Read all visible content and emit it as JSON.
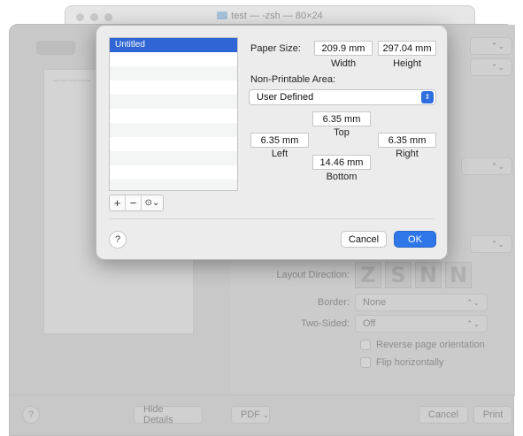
{
  "terminal": {
    "title": "test — -zsh — 80×24"
  },
  "print_dialog": {
    "preview_text": "Lorem ipsum. To be or not to be",
    "layout_direction_label": "Layout Direction:",
    "layout_icons": [
      "Z",
      "S",
      "N",
      "N"
    ],
    "border_label": "Border:",
    "border_value": "None",
    "two_sided_label": "Two-Sided:",
    "two_sided_value": "Off",
    "reverse_label": "Reverse page orientation",
    "flip_label": "Flip horizontally",
    "help_label": "?",
    "hide_details_label": "Hide Details",
    "pdf_label": "PDF",
    "cancel_label": "Cancel",
    "print_label": "Print"
  },
  "custom_paper": {
    "list_items": [
      "Untitled"
    ],
    "paper_size_label": "Paper Size:",
    "width_value": "209.9 mm",
    "width_label": "Width",
    "height_value": "297.04 mm",
    "height_label": "Height",
    "non_printable_label": "Non-Printable Area:",
    "non_printable_value": "User Defined",
    "top_value": "6.35 mm",
    "top_label": "Top",
    "left_value": "6.35 mm",
    "left_label": "Left",
    "right_value": "6.35 mm",
    "right_label": "Right",
    "bottom_value": "14.46 mm",
    "bottom_label": "Bottom",
    "add_label": "+",
    "remove_label": "−",
    "gear_label": "⊙⌄",
    "help_label": "?",
    "cancel_label": "Cancel",
    "ok_label": "OK"
  },
  "colors": {
    "accent": "#2f76e8",
    "selection": "#2f65d4"
  }
}
